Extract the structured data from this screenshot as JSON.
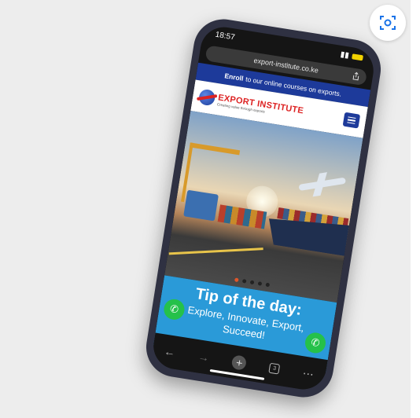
{
  "status": {
    "time": "18:57"
  },
  "browser": {
    "url": "export-institute.co.ke"
  },
  "banner": {
    "lead": "Enroll",
    "text": "to our online courses on exports."
  },
  "site": {
    "logo_prefix": "EXPORT",
    "logo_suffix": "INSTITUTE",
    "tagline": "Creating value through exports"
  },
  "tip": {
    "title": "Tip of the day:",
    "line1": "Explore, Innovate, Export,",
    "line2": "Succeed!"
  },
  "icons": {
    "lens": "lens-icon",
    "share": "share-icon",
    "menu": "menu-icon",
    "call": "phone-icon",
    "whatsapp": "whatsapp-icon",
    "back": "back-arrow-icon",
    "forward": "forward-arrow-icon",
    "new_tab": "plus-icon",
    "tabs": "tabs-icon",
    "more": "more-icon"
  },
  "bottom": {
    "tabs_count": "3"
  },
  "colors": {
    "brand_blue": "#1d3a9a",
    "brand_red": "#d22222",
    "tip_blue": "#2a9ad8",
    "whatsapp_green": "#25c14a"
  }
}
